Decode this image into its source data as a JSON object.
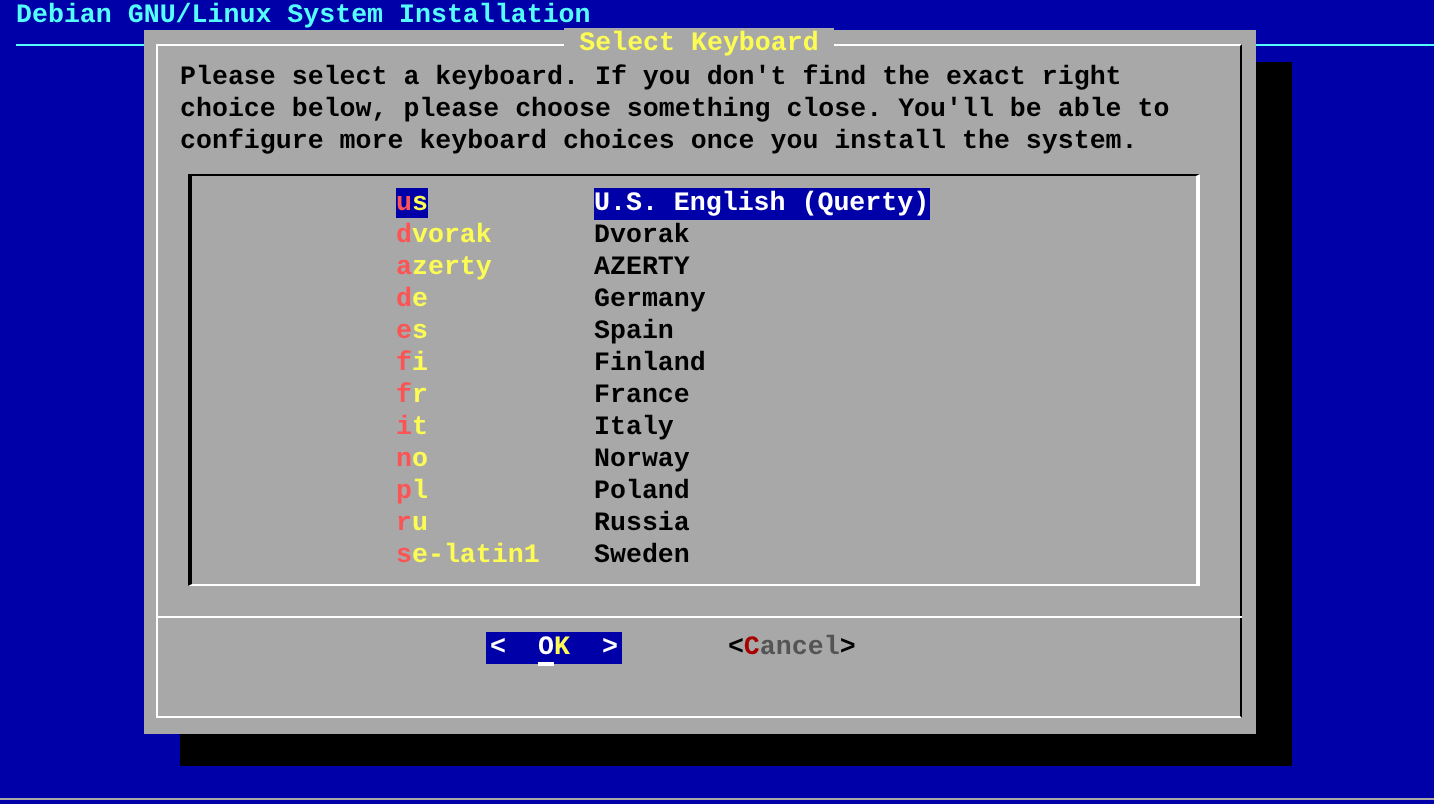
{
  "screen_title": "Debian GNU/Linux System Installation",
  "dialog": {
    "title": "Select Keyboard",
    "message": "Please select a keyboard. If you don't find the exact right choice below, please choose something close. You'll be able to configure more keyboard choices once you install the system.",
    "items": [
      {
        "key": "us",
        "description": "U.S. English (Querty)",
        "selected": true
      },
      {
        "key": "dvorak",
        "description": "Dvorak",
        "selected": false
      },
      {
        "key": "azerty",
        "description": "AZERTY",
        "selected": false
      },
      {
        "key": "de",
        "description": "Germany",
        "selected": false
      },
      {
        "key": "es",
        "description": "Spain",
        "selected": false
      },
      {
        "key": "fi",
        "description": "Finland",
        "selected": false
      },
      {
        "key": "fr",
        "description": "France",
        "selected": false
      },
      {
        "key": "it",
        "description": "Italy",
        "selected": false
      },
      {
        "key": "no",
        "description": "Norway",
        "selected": false
      },
      {
        "key": "pl",
        "description": "Poland",
        "selected": false
      },
      {
        "key": "ru",
        "description": "Russia",
        "selected": false
      },
      {
        "key": "se-latin1",
        "description": "Sweden",
        "selected": false
      }
    ],
    "buttons": [
      {
        "left": "<",
        "label": "OK",
        "right": ">",
        "selected": true
      },
      {
        "left": "<",
        "label": "Cancel",
        "right": ">",
        "selected": false
      }
    ]
  }
}
